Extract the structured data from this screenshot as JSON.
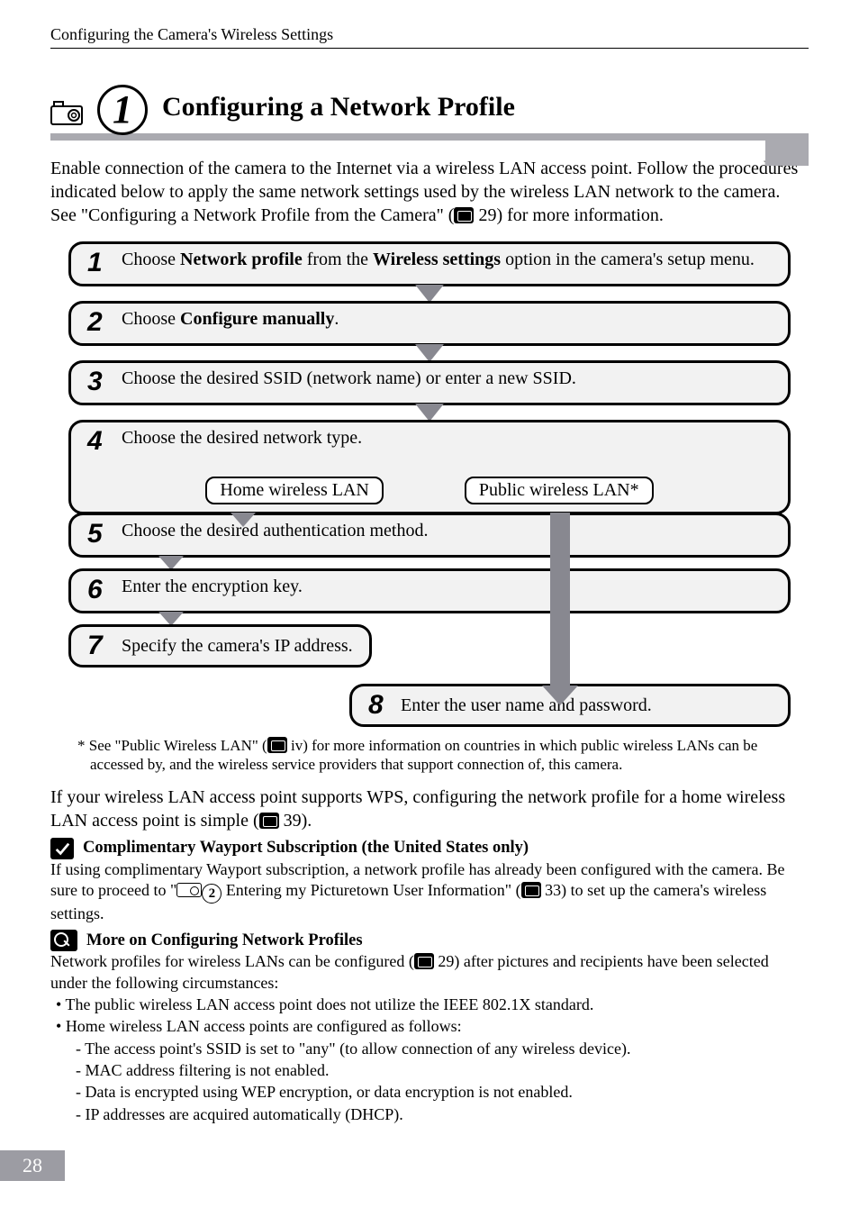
{
  "running_head": "Configuring the Camera's Wireless Settings",
  "section": {
    "number": "1",
    "title": "Configuring a Network Profile"
  },
  "intro": {
    "before_ref": "Enable connection of the camera to the Internet via a wireless LAN access point. Follow the procedures indicated below to apply the same network settings used by the wireless LAN network to the camera. See \"Configuring a Network Profile from the Camera\" (",
    "ref": " 29) for more information."
  },
  "steps": {
    "s1": {
      "num": "1",
      "pre": "Choose ",
      "b1": "Network profile",
      "mid": " from the ",
      "b2": "Wireless settings",
      "post": " option in the camera's setup menu."
    },
    "s2": {
      "num": "2",
      "pre": "Choose ",
      "b1": "Configure manually",
      "post": "."
    },
    "s3": {
      "num": "3",
      "text": "Choose the desired SSID (network name) or enter a new SSID."
    },
    "s4": {
      "num": "4",
      "text": "Choose the desired network type.",
      "opt_home": "Home wireless LAN",
      "opt_public": "Public wireless LAN*"
    },
    "s5": {
      "num": "5",
      "text": "Choose the desired authentication method."
    },
    "s6": {
      "num": "6",
      "text": "Enter the encryption key."
    },
    "s7": {
      "num": "7",
      "text": "Specify the camera's IP address."
    },
    "s8": {
      "num": "8",
      "text": "Enter the user name and password."
    }
  },
  "footnote": {
    "pre": "* See \"Public Wireless LAN\" (",
    "post": " iv) for more information on countries in which public wireless LANs can be accessed by, and the wireless service providers that support connection of, this camera."
  },
  "wps": {
    "pre": "If your wireless LAN access point supports WPS, configuring the network profile for a home wireless LAN access point is simple (",
    "post": " 39)."
  },
  "note1": {
    "title": "Complimentary Wayport Subscription (the United States only)",
    "p1a": "If using complimentary Wayport subscription, a network profile has already been configured with the camera. Be sure to proceed to \"",
    "circ": "2",
    "p1b": " Entering my Picturetown User Information\" (",
    "p1c": " 33) to set up the camera's wireless settings."
  },
  "note2": {
    "title": "More on Configuring Network Profiles",
    "p1a": "Network profiles for wireless LANs can be configured (",
    "p1b": " 29) after pictures and recipients have been selected under the following circumstances:",
    "b1": "The public wireless LAN access point does not utilize the IEEE 802.1X standard.",
    "b2": "Home wireless LAN access points are configured as follows:",
    "d1": "The access point's SSID is set to \"any\" (to allow connection of any wireless device).",
    "d2": "MAC address filtering is not enabled.",
    "d3": "Data is encrypted using WEP encryption, or data encryption is not enabled.",
    "d4": "IP addresses are acquired automatically (DHCP)."
  },
  "page_number": "28"
}
